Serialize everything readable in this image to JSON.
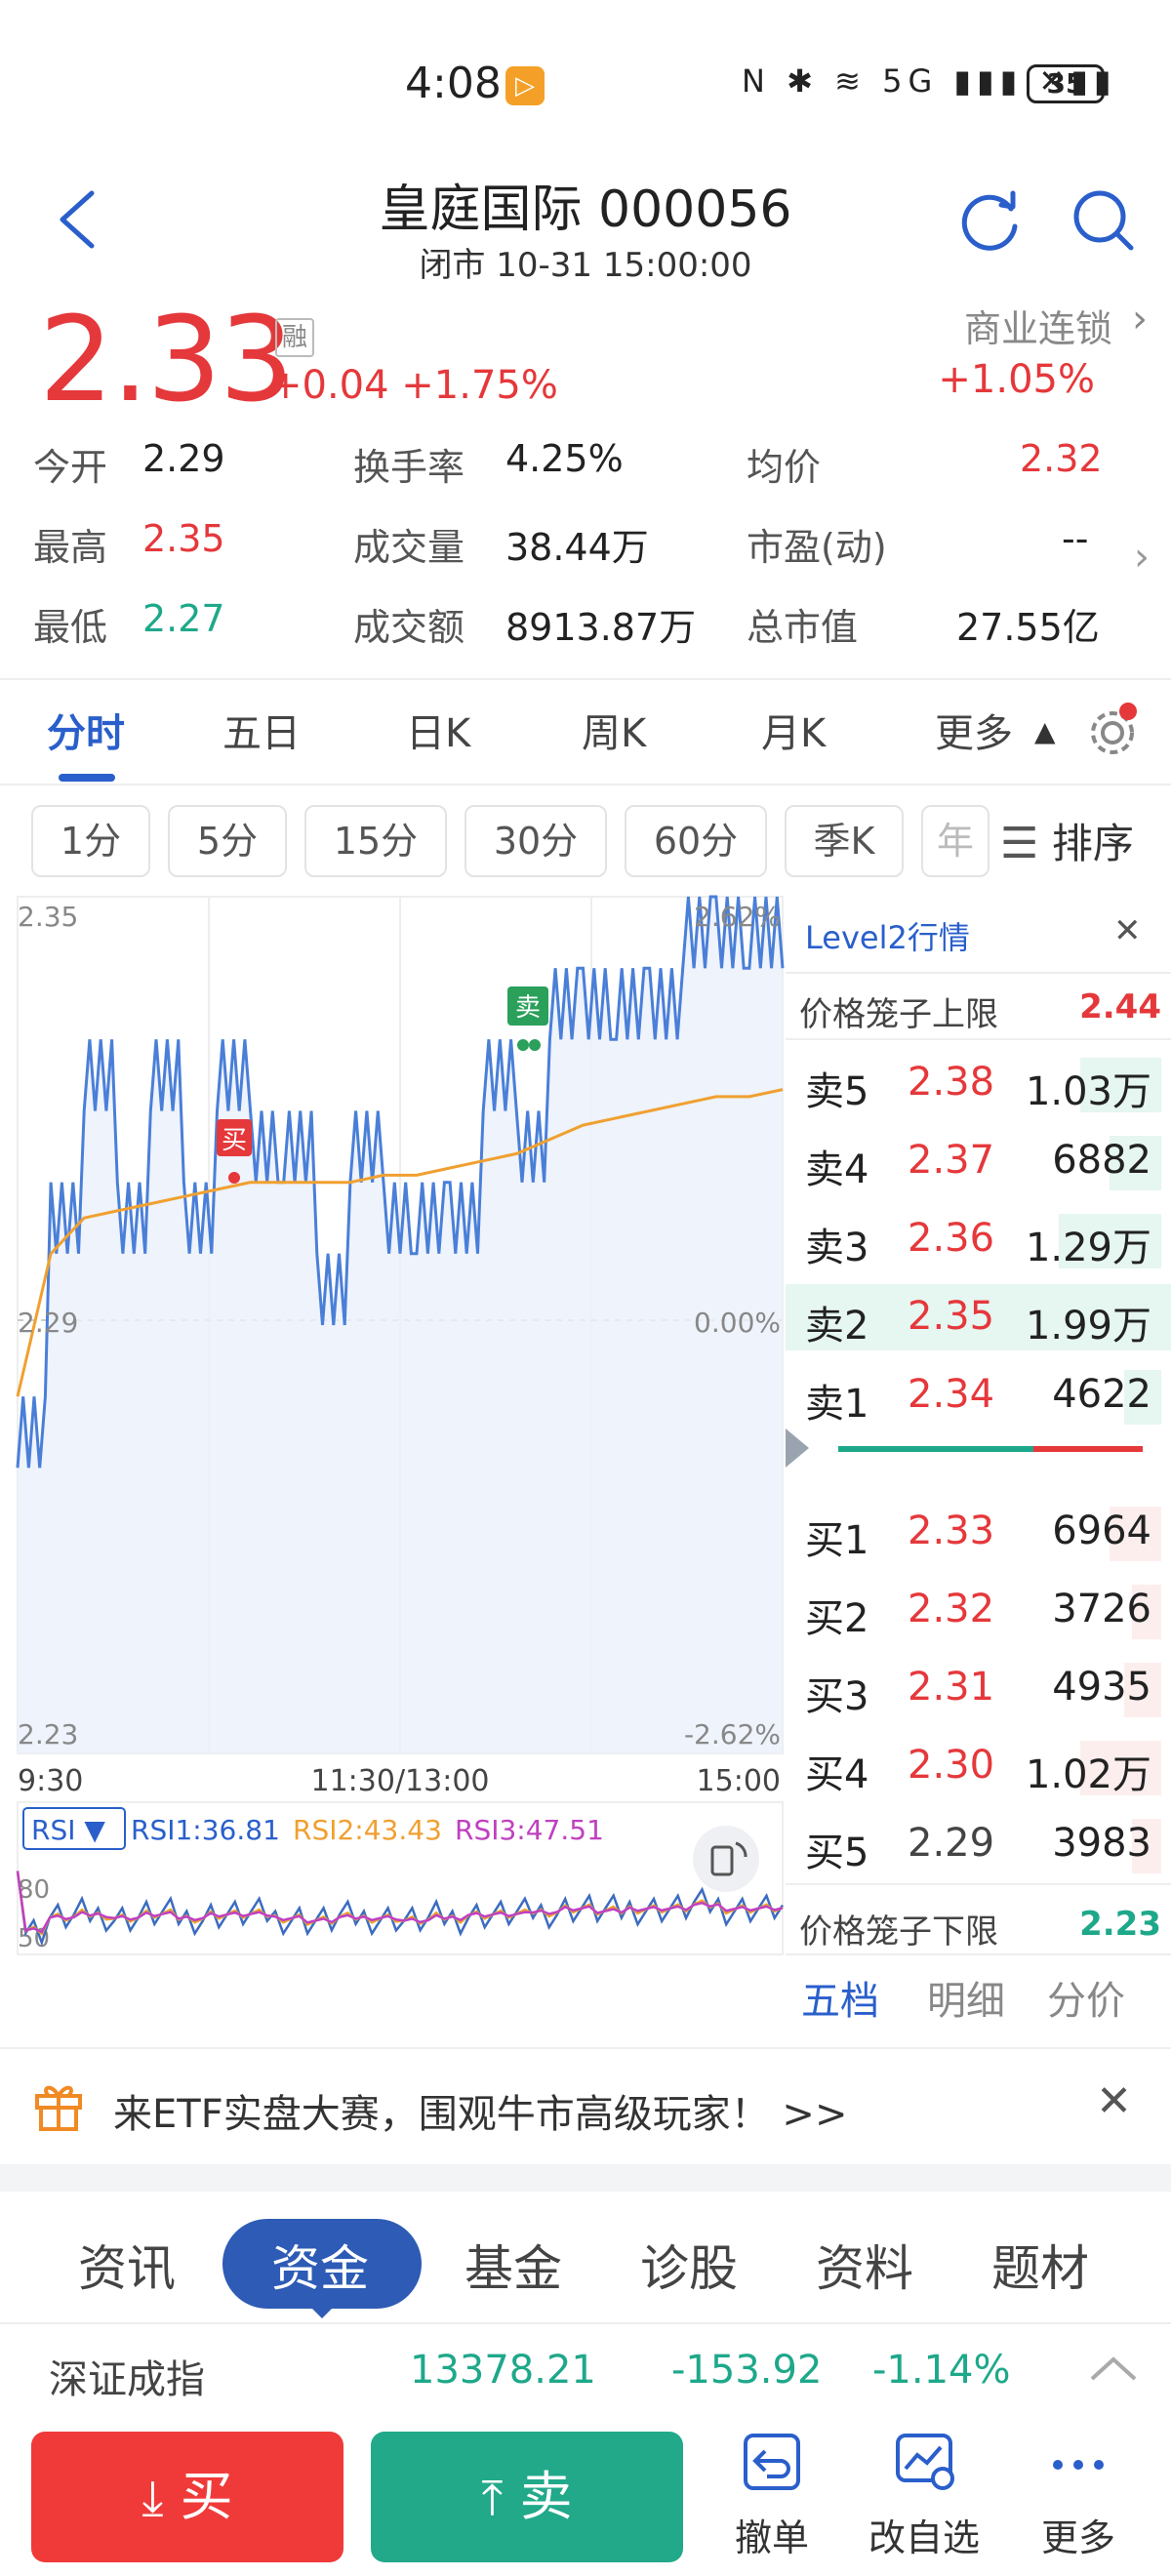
{
  "status_bar": {
    "time": "4:08",
    "badge": "▷",
    "icons_text": "N ✱ ≋ 5G ▮▮▮ ✕▮▮",
    "battery": "35"
  },
  "header": {
    "title": "皇庭国际 000056",
    "subtitle": "闭市 10-31 15:00:00"
  },
  "quote": {
    "price": "2.33",
    "rong": "融",
    "change": "+0.04  +1.75%",
    "sector_name": "商业连锁",
    "sector_change": "+1.05%"
  },
  "stats": {
    "open_label": "今开",
    "open": "2.29",
    "turnover_rate_label": "换手率",
    "turnover_rate": "4.25%",
    "avg_label": "均价",
    "avg": "2.32",
    "high_label": "最高",
    "high": "2.35",
    "volume_label": "成交量",
    "volume": "38.44万",
    "pe_label": "市盈(动)",
    "pe": "--",
    "low_label": "最低",
    "low": "2.27",
    "amount_label": "成交额",
    "amount": "8913.87万",
    "mcap_label": "总市值",
    "mcap": "27.55亿"
  },
  "period_tabs": [
    "分时",
    "五日",
    "日K",
    "周K",
    "月K",
    "更多"
  ],
  "intervals": [
    "1分",
    "5分",
    "15分",
    "30分",
    "60分",
    "季K",
    "年"
  ],
  "sort_label": "排序",
  "chart": {
    "y_top": "2.35",
    "y_mid": "2.29",
    "y_bottom": "2.23",
    "pct_top": "2.62%",
    "pct_mid": "0.00%",
    "pct_bottom": "-2.62%",
    "x_start": "9:30",
    "x_mid": "11:30/13:00",
    "x_end": "15:00",
    "buy_marker": "买",
    "sell_marker": "卖"
  },
  "chart_data": {
    "type": "line",
    "x": [
      "9:30",
      "11:30/13:00",
      "15:00"
    ],
    "ylim": [
      2.23,
      2.35
    ],
    "pct_range": [
      "-2.62%",
      "2.62%"
    ],
    "series": [
      {
        "values": [
          2.27,
          2.31,
          2.32,
          2.31,
          2.32,
          2.31,
          2.32,
          2.32,
          2.31,
          2.3,
          2.31,
          2.31,
          2.3,
          2.31,
          2.32,
          2.32,
          2.33,
          2.34,
          2.33,
          2.34,
          2.34,
          2.35,
          2.34,
          2.34
        ]
      },
      {
        "values": [
          2.28,
          2.3,
          2.305,
          2.306,
          2.307,
          2.308,
          2.309,
          2.31,
          2.31,
          2.31,
          2.31,
          2.311,
          2.311,
          2.312,
          2.313,
          2.314,
          2.316,
          2.318,
          2.319,
          2.32,
          2.321,
          2.322,
          2.322,
          2.323
        ]
      }
    ]
  },
  "rsi": {
    "selector": "RSI ▼",
    "rsi1": "RSI1:36.81",
    "rsi2": "RSI2:43.43",
    "rsi3": "RSI3:47.51",
    "y80": "80",
    "y50": "50"
  },
  "level2": {
    "title": "Level2行情",
    "upper_label": "价格笼子上限",
    "upper": "2.44",
    "lower_label": "价格笼子下限",
    "lower": "2.23",
    "sells": [
      {
        "side": "卖5",
        "price": "2.38",
        "vol": "1.03万",
        "fill": 0.55
      },
      {
        "side": "卖4",
        "price": "2.37",
        "vol": "6882",
        "fill": 0.35
      },
      {
        "side": "卖3",
        "price": "2.36",
        "vol": "1.29万",
        "fill": 0.7
      },
      {
        "side": "卖2",
        "price": "2.35",
        "vol": "1.99万",
        "fill": 1.0
      },
      {
        "side": "卖1",
        "price": "2.34",
        "vol": "4622",
        "fill": 0.25
      }
    ],
    "buys": [
      {
        "side": "买1",
        "price": "2.33",
        "vol": "6964",
        "fill": 0.35
      },
      {
        "side": "买2",
        "price": "2.32",
        "vol": "3726",
        "fill": 0.2
      },
      {
        "side": "买3",
        "price": "2.31",
        "vol": "4935",
        "fill": 0.25
      },
      {
        "side": "买4",
        "price": "2.30",
        "vol": "1.02万",
        "fill": 0.55
      },
      {
        "side": "买5",
        "price": "2.29",
        "vol": "3983",
        "fill": 0.2
      }
    ],
    "tabs": [
      "五档",
      "明细",
      "分价"
    ]
  },
  "promo": {
    "text": "来ETF实盘大赛，围观牛市高级玩家！ >>"
  },
  "section_tabs": [
    "资讯",
    "资金",
    "基金",
    "诊股",
    "资料",
    "题材"
  ],
  "index": {
    "name": "深证成指",
    "value": "13378.21",
    "change": "-153.92",
    "pct": "-1.14%"
  },
  "actions": {
    "buy": "买",
    "sell": "卖",
    "cancel": "撤单",
    "watchlist": "改自选",
    "more": "更多"
  },
  "colors": {
    "up": "#e5383b",
    "down": "#1ea88a",
    "accent": "#2a5fcb",
    "avg_line": "#f0a030"
  }
}
